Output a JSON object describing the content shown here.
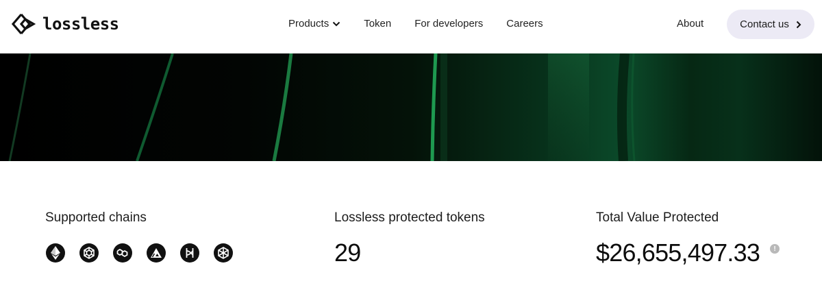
{
  "header": {
    "logo_text": "lossless",
    "nav": [
      {
        "label": "Products",
        "has_dropdown": true
      },
      {
        "label": "Token"
      },
      {
        "label": "For developers"
      },
      {
        "label": "Careers"
      }
    ],
    "about_label": "About",
    "contact_label": "Contact us"
  },
  "stats": {
    "chains": {
      "label": "Supported chains",
      "icons": [
        "ethereum-icon",
        "bnb-chain-icon",
        "polygon-icon",
        "avalanche-icon",
        "harmony-icon",
        "fantom-icon"
      ]
    },
    "tokens": {
      "label": "Lossless protected tokens",
      "value": "29"
    },
    "tvp": {
      "label": "Total Value Protected",
      "value": "$26,655,497.33",
      "info_icon": "info-icon"
    }
  },
  "colors": {
    "contact_bg": "#eceaf5",
    "hero_accent": "#1a9a4e",
    "icon_bg": "#111111"
  }
}
